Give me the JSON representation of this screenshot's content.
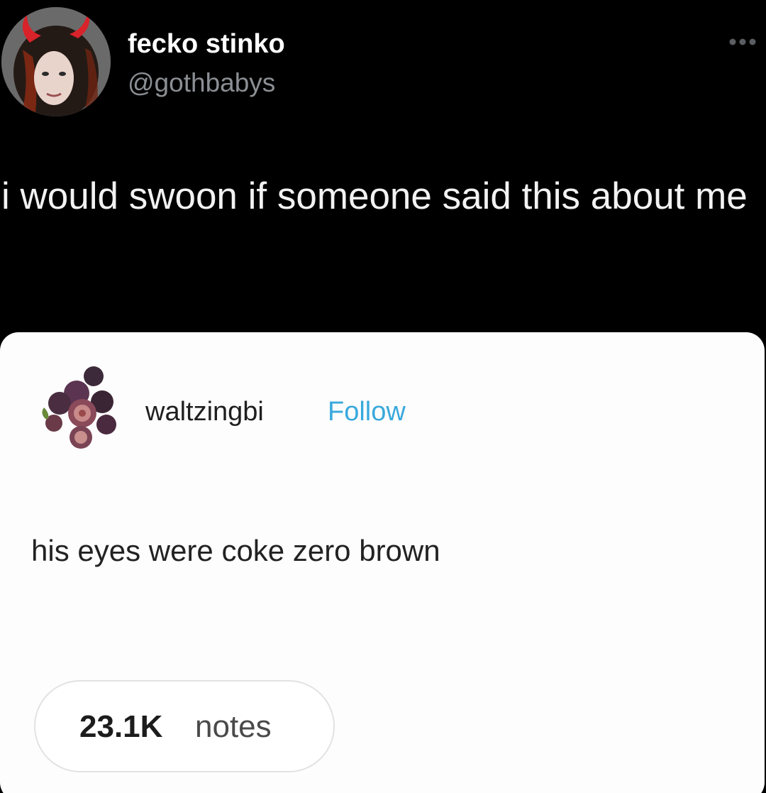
{
  "tweet": {
    "display_name": "fecko stinko",
    "handle": "@gothbabys",
    "text": "i would swoon if someone said this about me",
    "avatar_icon": "profile-photo-devil-horns",
    "more_icon": "more-options-dots-icon"
  },
  "embedded_post": {
    "username": "waltzingbi",
    "follow_label": "Follow",
    "body": "his eyes were coke zero brown",
    "notes_count": "23.1K",
    "notes_label": "notes",
    "avatar_icon": "figs-avatar",
    "colors": {
      "follow": "#39a9dc",
      "card_bg": "#fdfdfd"
    }
  }
}
